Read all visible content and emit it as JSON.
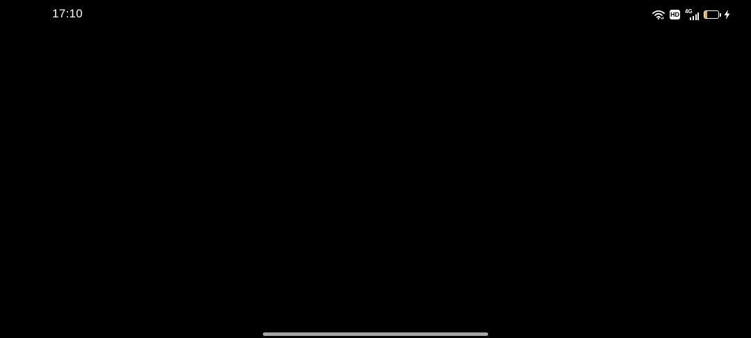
{
  "status_bar": {
    "time": "17:10",
    "hd_label": "HD",
    "network_type": "4G",
    "battery_level": "21",
    "battery_percent": 21,
    "battery_color": "#d9b45a",
    "icons": [
      "wifi-icon",
      "hd-voice-icon",
      "signal-icon",
      "battery-icon",
      "charging-icon"
    ]
  },
  "home_indicator_color": "#a6a6a6"
}
